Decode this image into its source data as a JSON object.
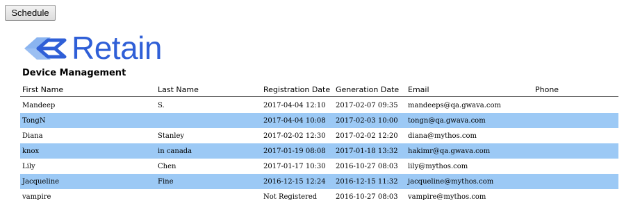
{
  "toolbar": {
    "schedule_label": "Schedule"
  },
  "brand": {
    "name": "Retain",
    "logo_icon": "retain-chevron-logo",
    "color": "#2f5fd7",
    "accent_light": "#8ab4f0"
  },
  "page": {
    "title": "Device Management"
  },
  "table": {
    "headers": {
      "first_name": "First Name",
      "last_name": "Last Name",
      "registration_date": "Registration Date",
      "generation_date": "Generation Date",
      "email": "Email",
      "phone": "Phone"
    },
    "row_highlight_color": "#9cc9f5",
    "rows": [
      {
        "first_name": "Mandeep",
        "last_name": "S.",
        "registration_date": "2017-04-04 12:10",
        "generation_date": "2017-02-07 09:35",
        "email": "mandeeps@qa.gwava.com",
        "phone": ""
      },
      {
        "first_name": "TongN",
        "last_name": "",
        "registration_date": "2017-04-04 10:08",
        "generation_date": "2017-02-03 10:00",
        "email": "tongn@qa.gwava.com",
        "phone": ""
      },
      {
        "first_name": "Diana",
        "last_name": "Stanley",
        "registration_date": "2017-02-02 12:30",
        "generation_date": "2017-02-02 12:20",
        "email": "diana@mythos.com",
        "phone": ""
      },
      {
        "first_name": "knox",
        "last_name": "in canada",
        "registration_date": "2017-01-19 08:08",
        "generation_date": "2017-01-18 13:32",
        "email": "hakimr@qa.gwava.com",
        "phone": ""
      },
      {
        "first_name": "Lily",
        "last_name": "Chen",
        "registration_date": "2017-01-17 10:30",
        "generation_date": "2016-10-27 08:03",
        "email": "lily@mythos.com",
        "phone": ""
      },
      {
        "first_name": "Jacqueline",
        "last_name": "Fine",
        "registration_date": "2016-12-15 12:24",
        "generation_date": "2016-12-15 11:32",
        "email": "jacqueline@mythos.com",
        "phone": ""
      },
      {
        "first_name": "vampire",
        "last_name": "",
        "registration_date": "Not Registered",
        "generation_date": "2016-10-27 08:03",
        "email": "vampire@mythos.com",
        "phone": ""
      }
    ]
  }
}
